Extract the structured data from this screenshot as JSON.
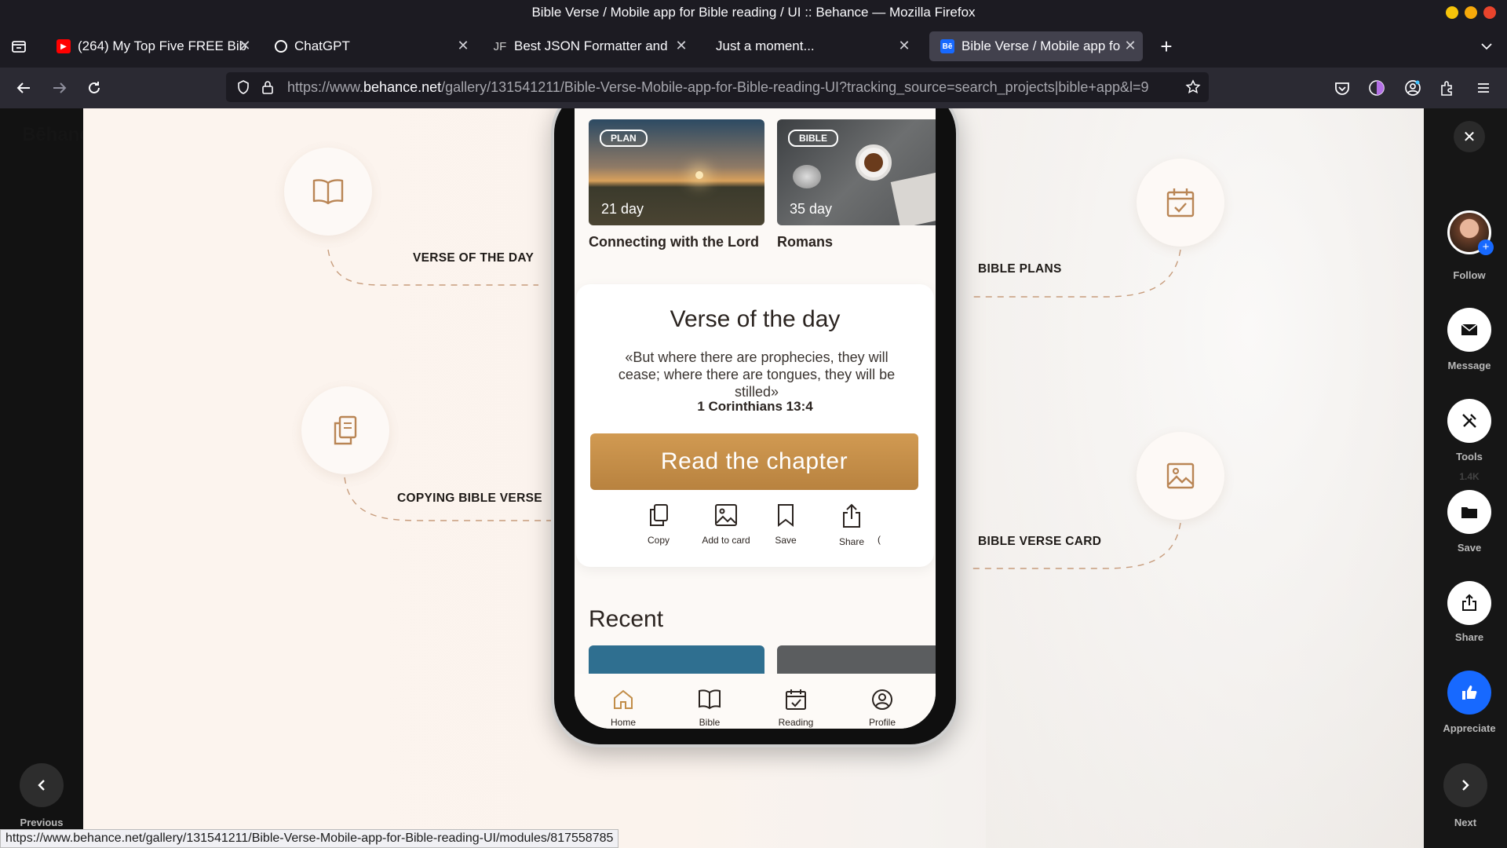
{
  "window": {
    "title": "Bible Verse / Mobile app for Bible reading / UI :: Behance — Mozilla Firefox"
  },
  "tabs": [
    {
      "label": "(264) My Top Five FREE Bib",
      "icon": "youtube-icon",
      "color": "#ff0000"
    },
    {
      "label": "ChatGPT",
      "icon": "chatgpt-icon"
    },
    {
      "label": "Best JSON Formatter and",
      "icon": "jf-icon"
    },
    {
      "label": "Just a moment...",
      "icon": "none"
    },
    {
      "label": "Bible Verse / Mobile app fo",
      "icon": "behance-icon",
      "color": "#1769ff"
    }
  ],
  "address": {
    "prefix": "https://www.",
    "domain": "behance.net",
    "path": "/gallery/131541211/Bible-Verse-Mobile-app-for-Bible-reading-UI?tracking_source=search_projects|bible+app&l=9"
  },
  "behance": {
    "logo": "Bēhance"
  },
  "features": {
    "verse_of_day": "VERSE  OF THE DAY",
    "copying": "COPYING BIBLE VERSE",
    "plans": "BIBLE PLANS",
    "card": "BIBLE VERSE CARD"
  },
  "app": {
    "cards": [
      {
        "tag": "PLAN",
        "days": "21 day",
        "title": "Connecting with the Lord"
      },
      {
        "tag": "BIBLE",
        "days": "35 day",
        "title": "Romans"
      }
    ],
    "verse": {
      "title": "Verse of the day",
      "text": "«But where there are prophecies, they will cease; where there are tongues, they will be stilled»",
      "reference": "1 Corinthians 13:4",
      "button": "Read the  chapter",
      "actions": [
        "Copy",
        "Add to card",
        "Save",
        "Share"
      ]
    },
    "recent": "Recent",
    "nav": [
      "Home",
      "Bible",
      "Reading",
      "Profile"
    ],
    "accent": "#c28d48"
  },
  "sidebar": {
    "follow": "Follow",
    "message": "Message",
    "tools": "Tools",
    "save": "Save",
    "share": "Share",
    "appreciate": "Appreciate",
    "views": "1.4K"
  },
  "pager": {
    "previous": "Previous",
    "next": "Next"
  },
  "statusbar": "https://www.behance.net/gallery/131541211/Bible-Verse-Mobile-app-for-Bible-reading-UI/modules/817558785"
}
